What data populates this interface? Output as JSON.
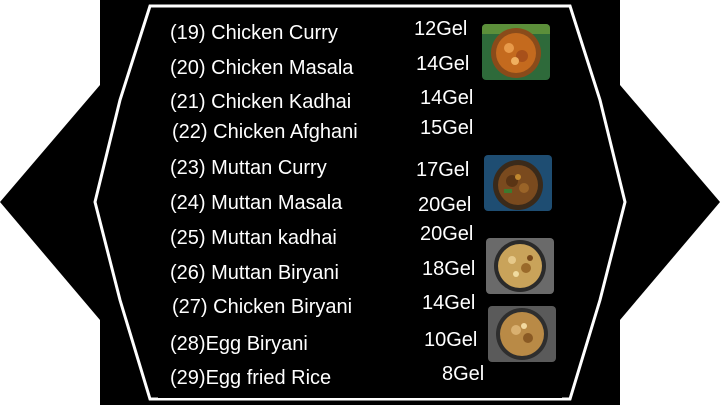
{
  "colors": {
    "background": "#000000",
    "border": "#ffffff",
    "text": "#ffffff",
    "page": "#ffffff"
  },
  "menu": {
    "items": [
      {
        "name": "(19) Chicken Curry",
        "price": "12Gel"
      },
      {
        "name": "(20) Chicken Masala",
        "price": "14Gel"
      },
      {
        "name": "(21) Chicken Kadhai",
        "price": "14Gel"
      },
      {
        "name": "(22) Chicken Afghani",
        "price": "15Gel"
      },
      {
        "name": "(23) Muttan Curry",
        "price": "17Gel"
      },
      {
        "name": "(24) Muttan Masala",
        "price": "20Gel"
      },
      {
        "name": "(25) Muttan kadhai",
        "price": "20Gel"
      },
      {
        "name": "(26) Muttan Biryani",
        "price": "18Gel"
      },
      {
        "name": "(27) Chicken Biryani",
        "price": "14Gel"
      },
      {
        "name": "(28)Egg Biryani",
        "price": "10Gel"
      },
      {
        "name": "(29)Egg fried Rice",
        "price": "8Gel"
      }
    ],
    "photos": [
      {
        "icon": "chicken-curry-photo-icon"
      },
      {
        "icon": "muttan-curry-photo-icon"
      },
      {
        "icon": "biryani-photo-icon"
      },
      {
        "icon": "chicken-biryani-photo-icon"
      }
    ]
  }
}
